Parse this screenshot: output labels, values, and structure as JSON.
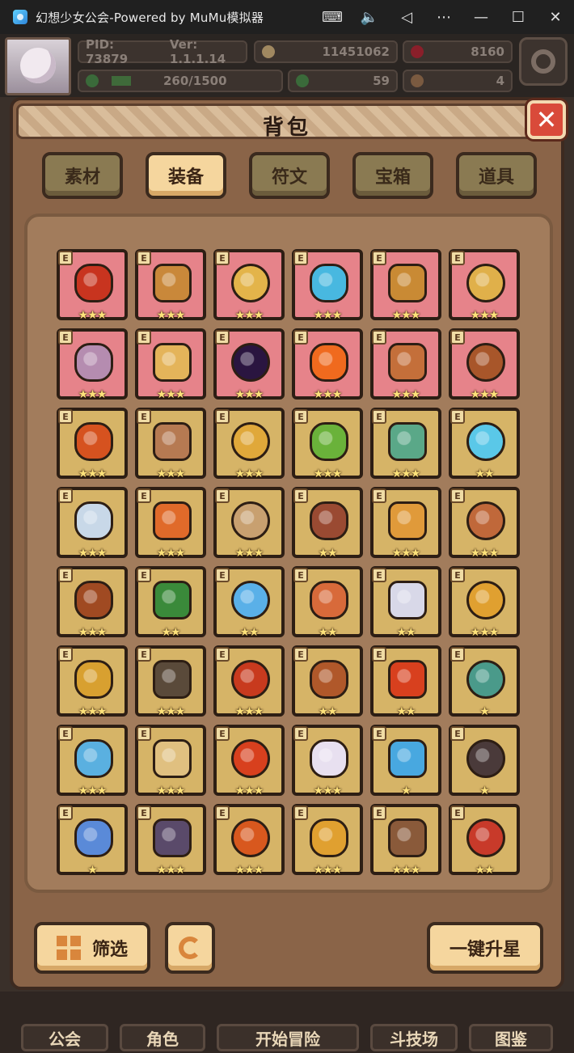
{
  "window": {
    "title": "幻想少女公会-Powered by MuMu模拟器",
    "controls": [
      "keyboard-icon",
      "volume-icon",
      "back-icon",
      "more-icon",
      "minimize-icon",
      "maximize-icon",
      "close-icon"
    ]
  },
  "hud": {
    "pid": "PID: 73879",
    "version": "Ver: 1.1.1.14",
    "gold": "11451062",
    "gems": "8160",
    "exp": "260/1500",
    "clover": "59",
    "other": "4"
  },
  "panel": {
    "title": "背包",
    "tabs": [
      {
        "label": "素材",
        "active": false
      },
      {
        "label": "装备",
        "active": true
      },
      {
        "label": "符文",
        "active": false
      },
      {
        "label": "宝箱",
        "active": false
      },
      {
        "label": "道具",
        "active": false
      }
    ],
    "items": [
      {
        "name": "red-wings",
        "bg": "red",
        "stars": "★★★",
        "color": "#c8341f"
      },
      {
        "name": "wooden-staff",
        "bg": "red",
        "stars": "★★★",
        "color": "#c9883a"
      },
      {
        "name": "straw-hat",
        "bg": "red",
        "stars": "★★★",
        "color": "#e3b44a"
      },
      {
        "name": "ice-helmet",
        "bg": "red",
        "stars": "★★★",
        "color": "#48b8e0"
      },
      {
        "name": "golden-horns",
        "bg": "red",
        "stars": "★★★",
        "color": "#c98a34"
      },
      {
        "name": "gold-amulet",
        "bg": "red",
        "stars": "★★★",
        "color": "#e0b04a"
      },
      {
        "name": "chain-necklace",
        "bg": "red",
        "stars": "★★★",
        "color": "#b58cb0"
      },
      {
        "name": "gold-ring",
        "bg": "red",
        "stars": "★★★",
        "color": "#e4b45a"
      },
      {
        "name": "dark-orb",
        "bg": "red",
        "stars": "★★★",
        "color": "#2a1540"
      },
      {
        "name": "fire-ring",
        "bg": "red",
        "stars": "★★★",
        "color": "#f06a1e"
      },
      {
        "name": "bread-ring",
        "bg": "red",
        "stars": "★★★",
        "color": "#c46f3a"
      },
      {
        "name": "crossbow",
        "bg": "red",
        "stars": "★★★",
        "color": "#a8562a"
      },
      {
        "name": "fire-torch",
        "bg": "gold",
        "stars": "★★★",
        "color": "#d6521f"
      },
      {
        "name": "battle-axe",
        "bg": "gold",
        "stars": "★★★",
        "color": "#b67a52"
      },
      {
        "name": "golden-scepter",
        "bg": "gold",
        "stars": "★★★",
        "color": "#e0a83a"
      },
      {
        "name": "green-wand",
        "bg": "gold",
        "stars": "★★★",
        "color": "#6ab23a"
      },
      {
        "name": "jade-mace",
        "bg": "gold",
        "stars": "★★★",
        "color": "#5aa888"
      },
      {
        "name": "crystal-wand",
        "bg": "gold",
        "stars": "★★",
        "color": "#5ac8e8"
      },
      {
        "name": "crossed-swords",
        "bg": "gold",
        "stars": "★★★",
        "color": "#c8d8e8"
      },
      {
        "name": "flame-rod",
        "bg": "gold",
        "stars": "★★★",
        "color": "#e06a2a"
      },
      {
        "name": "crystal-shield",
        "bg": "gold",
        "stars": "★★★",
        "color": "#c8a070"
      },
      {
        "name": "wood-shield",
        "bg": "gold",
        "stars": "★★",
        "color": "#9a4a32"
      },
      {
        "name": "gold-crab",
        "bg": "gold",
        "stars": "★★★",
        "color": "#e09a3a"
      },
      {
        "name": "bronze-bracer",
        "bg": "gold",
        "stars": "★★★",
        "color": "#c0683a"
      },
      {
        "name": "bronze-helmet",
        "bg": "gold",
        "stars": "★★★",
        "color": "#a04a22"
      },
      {
        "name": "green-hat",
        "bg": "gold",
        "stars": "★★",
        "color": "#3a8a3a"
      },
      {
        "name": "blue-hat",
        "bg": "gold",
        "stars": "★★",
        "color": "#5ab0e8"
      },
      {
        "name": "red-amulet",
        "bg": "gold",
        "stars": "★★",
        "color": "#d86a3a"
      },
      {
        "name": "silver-crown",
        "bg": "gold",
        "stars": "★★",
        "color": "#d8d8e8"
      },
      {
        "name": "gold-helm",
        "bg": "gold",
        "stars": "★★★",
        "color": "#e0a030"
      },
      {
        "name": "gold-vest",
        "bg": "gold",
        "stars": "★★★",
        "color": "#d8a030"
      },
      {
        "name": "dark-armor",
        "bg": "gold",
        "stars": "★★★",
        "color": "#5a4a3a"
      },
      {
        "name": "red-armor",
        "bg": "gold",
        "stars": "★★★",
        "color": "#c83a1e"
      },
      {
        "name": "leather-armor",
        "bg": "gold",
        "stars": "★★",
        "color": "#b0582a"
      },
      {
        "name": "flame-armor",
        "bg": "gold",
        "stars": "★★",
        "color": "#d8401e"
      },
      {
        "name": "jade-armor",
        "bg": "gold",
        "stars": "★",
        "color": "#4a9a8a"
      },
      {
        "name": "ice-gauntlet",
        "bg": "gold",
        "stars": "★★★",
        "color": "#5ab0e0"
      },
      {
        "name": "bone-gauntlet",
        "bg": "gold",
        "stars": "★★★",
        "color": "#e0c080"
      },
      {
        "name": "flame-gauntlet",
        "bg": "gold",
        "stars": "★★★",
        "color": "#d8401e"
      },
      {
        "name": "spirit-gauntlet",
        "bg": "gold",
        "stars": "★★★",
        "color": "#e8e0f0"
      },
      {
        "name": "ice-boot",
        "bg": "gold",
        "stars": "★",
        "color": "#48a8e0"
      },
      {
        "name": "demon-gauntlet",
        "bg": "gold",
        "stars": "★",
        "color": "#4a3a3a"
      },
      {
        "name": "scroll",
        "bg": "gold",
        "stars": "★",
        "color": "#5a8ad8"
      },
      {
        "name": "mystic-ring",
        "bg": "gold",
        "stars": "★★★",
        "color": "#5a4a6a"
      },
      {
        "name": "flame-ring-2",
        "bg": "gold",
        "stars": "★★★",
        "color": "#d8581e"
      },
      {
        "name": "gold-band",
        "bg": "gold",
        "stars": "★★★",
        "color": "#e0a030"
      },
      {
        "name": "gem-ring",
        "bg": "gold",
        "stars": "★★★",
        "color": "#8a5a3a"
      },
      {
        "name": "ruby-ring",
        "bg": "gold",
        "stars": "★★",
        "color": "#c83a2a"
      }
    ],
    "buttons": {
      "filter": "筛选",
      "upgrade_all": "一键升星"
    }
  },
  "nav": [
    {
      "label": "公会"
    },
    {
      "label": "角色"
    },
    {
      "label": "开始冒险"
    },
    {
      "label": "斗技场"
    },
    {
      "label": "图鉴"
    }
  ]
}
